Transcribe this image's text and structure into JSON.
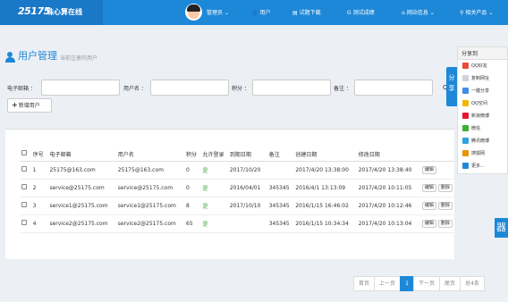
{
  "header": {
    "logo_text": "25175",
    "site_title": "珠心算在线",
    "nav": [
      {
        "label": "管理员",
        "icon": "chevron-down"
      },
      {
        "label": "用户",
        "icon": "user-icon"
      },
      {
        "label": "试题下载",
        "icon": "file-icon"
      },
      {
        "label": "测试成绩",
        "icon": "g-icon"
      },
      {
        "label": "网站信息",
        "icon": "home-icon"
      },
      {
        "label": "相关产品",
        "icon": "link-icon"
      }
    ]
  },
  "page": {
    "title": "用户管理",
    "subtitle": "当前注册的用户"
  },
  "filters": {
    "email_label": "电子邮箱 ：",
    "username_label": "用户名 ：",
    "points_label": "积分 ：",
    "note_label": "备注 ："
  },
  "actions": {
    "add_user": "新增用户",
    "search_icon_text": "Q"
  },
  "table": {
    "headers": [
      "序号",
      "电子邮箱",
      "用户名",
      "积分",
      "允许登录",
      "到期日期",
      "备注",
      "创建日期",
      "修改日期"
    ],
    "rows": [
      {
        "no": "1",
        "email": "25175@163.com",
        "username": "25175@163.com",
        "points": "0",
        "allowed": "是",
        "expire": "2017/10/20",
        "note": "",
        "created": "2017/4/20 13:38:00",
        "modified": "2017/4/20 13:38:40",
        "ops": [
          "编辑"
        ]
      },
      {
        "no": "2",
        "email": "service@25175.com",
        "username": "service@25175.com",
        "points": "0",
        "allowed": "是",
        "expire": "2016/04/01",
        "note": "345345",
        "created": "2016/4/1 13:13:09",
        "modified": "2017/4/20 10:11:05",
        "ops": [
          "编辑",
          "删除"
        ]
      },
      {
        "no": "3",
        "email": "service1@25175.com",
        "username": "service1@25175.com",
        "points": "8",
        "allowed": "是",
        "expire": "2017/10/10",
        "note": "345345",
        "created": "2016/1/15 16:46:02",
        "modified": "2017/4/20 10:12:46",
        "ops": [
          "编辑",
          "删除"
        ]
      },
      {
        "no": "4",
        "email": "service2@25175.com",
        "username": "service2@25175.com",
        "points": "65",
        "allowed": "是",
        "expire": "",
        "note": "345345",
        "created": "2016/1/15 10:34:34",
        "modified": "2017/4/20 10:13:04",
        "ops": [
          "编辑",
          "删除"
        ]
      }
    ]
  },
  "share": {
    "title": "分享到",
    "tab_label": "分享",
    "items": [
      {
        "label": "QQ好友",
        "color": "#e84a3b"
      },
      {
        "label": "复制网址",
        "color": "#cfd4da"
      },
      {
        "label": "一键分享",
        "color": "#3d8ee8"
      },
      {
        "label": "QQ空间",
        "color": "#f2b600"
      },
      {
        "label": "新浪微博",
        "color": "#e6162d"
      },
      {
        "label": "微信",
        "color": "#3cb034"
      },
      {
        "label": "腾讯微博",
        "color": "#2ba3e0"
      },
      {
        "label": "搜狐网",
        "color": "#e69500"
      },
      {
        "label": "更多...",
        "color": "#1e88d8"
      }
    ],
    "qr_text": "器"
  },
  "pager": {
    "items": [
      "首页",
      "上一页",
      "1",
      "下一页",
      "尾页",
      "总4条"
    ],
    "current": "1"
  }
}
